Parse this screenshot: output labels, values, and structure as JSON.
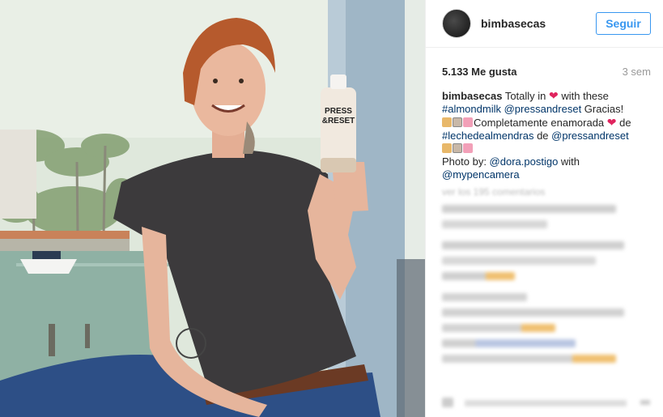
{
  "post": {
    "username": "bimbasecas",
    "follow_label": "Seguir",
    "likes": "5.133 Me gusta",
    "age": "3 sem",
    "caption": {
      "t1": " Totally in ",
      "t2": " with these",
      "t3": "#almondmilk",
      "t4": "@pressandreset",
      "t5": " Gracias!",
      "t6": "Completamente enamorada ",
      "t7": " de",
      "t8": "#lechedealmendras",
      "t9": " de ",
      "t10": "@pressandreset",
      "t11": "Photo by: ",
      "t12": "@dora.postigo",
      "t13": " with",
      "t14": "@mypencamera"
    },
    "view_all": "ver los 195 comentarios"
  },
  "bottle": {
    "brand_line1": "PRESS",
    "brand_line2": "&RESET"
  },
  "colors": {
    "accent": "#3897f0",
    "link": "#003569",
    "heart": "#e0245e"
  }
}
